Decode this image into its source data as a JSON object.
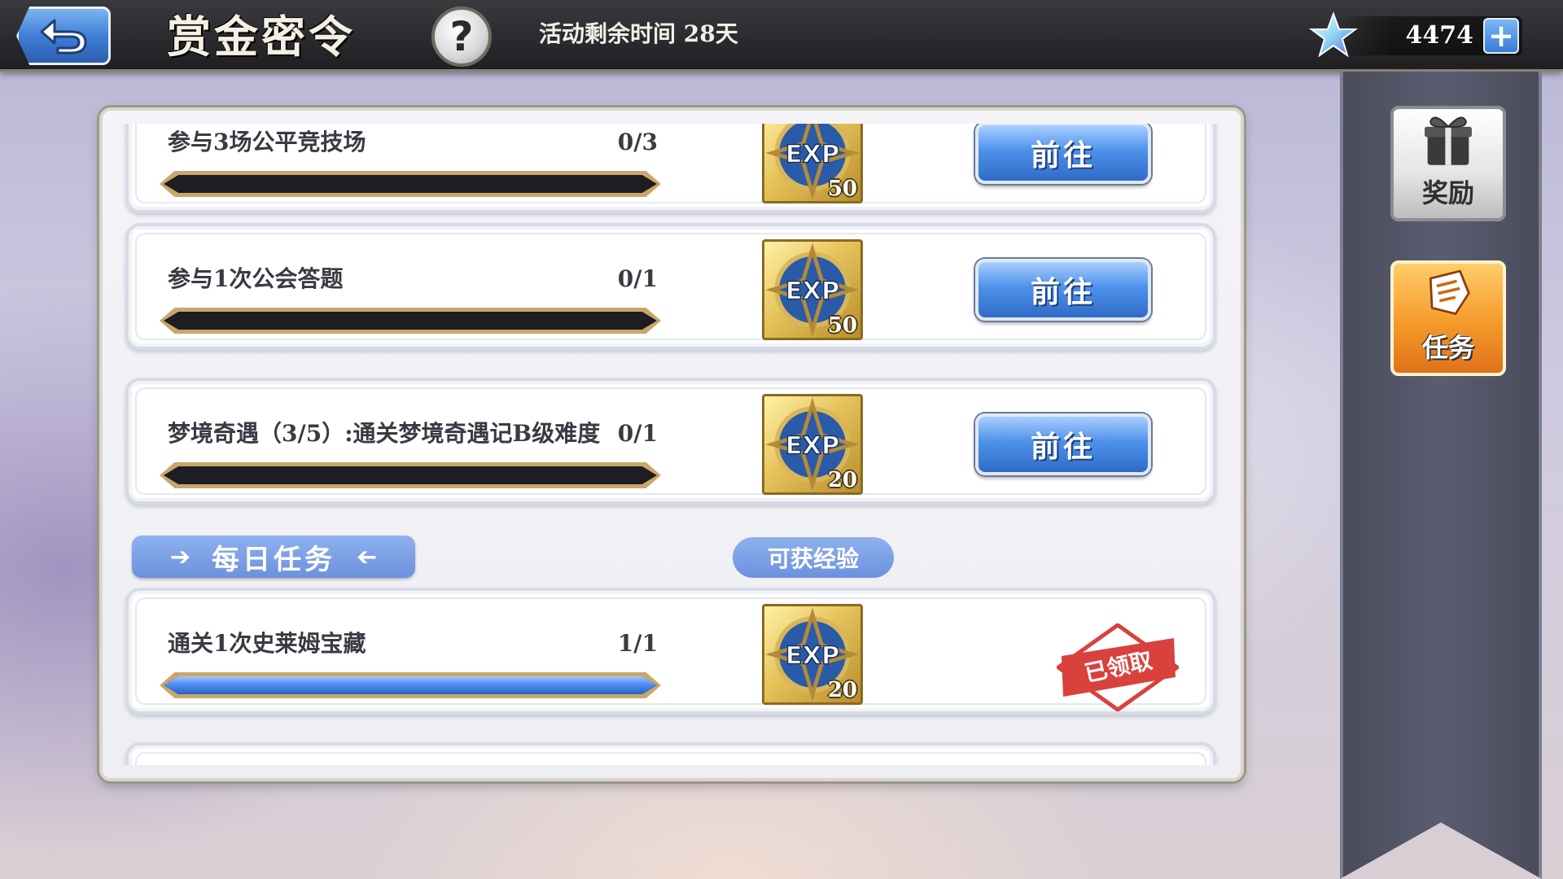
{
  "header": {
    "title": "赏金密令",
    "time_remaining": "活动剩余时间  28天",
    "currency_value": "4474",
    "help_symbol": "?",
    "plus_symbol": "+"
  },
  "sidebar": {
    "reward_label": "奖励",
    "task_label": "任务"
  },
  "tasks_top": [
    {
      "name": "参与3场公平竞技场",
      "progress_text": "0/3",
      "progress": 0.0,
      "exp": "50",
      "action": "前往"
    },
    {
      "name": "参与1次公会答题",
      "progress_text": "0/1",
      "progress": 0.0,
      "exp": "50",
      "action": "前往"
    },
    {
      "name": "梦境奇遇（3/5）:通关梦境奇遇记B级难度",
      "progress_text": "0/1",
      "progress": 0.0,
      "exp": "20",
      "action": "前往"
    }
  ],
  "daily_section": {
    "title": "每日任务",
    "exp_label": "可获经验"
  },
  "tasks_daily": [
    {
      "name": "通关1次史莱姆宝藏",
      "progress_text": "1/1",
      "progress": 1.0,
      "exp": "20",
      "status": "已领取"
    }
  ],
  "icons": {
    "back": "back-arrow-icon",
    "help": "question-icon",
    "currency": "star-crystal-icon",
    "plus": "plus-icon",
    "reward": "gift-icon",
    "task": "task-scroll-icon",
    "exp": "exp-badge-icon",
    "claimed": "claimed-stamp-icon"
  },
  "colors": {
    "accent_blue": "#4f91ea",
    "task_orange": "#f59a2a",
    "claimed_red": "#d9413d",
    "exp_gold": "#e6c25a"
  }
}
